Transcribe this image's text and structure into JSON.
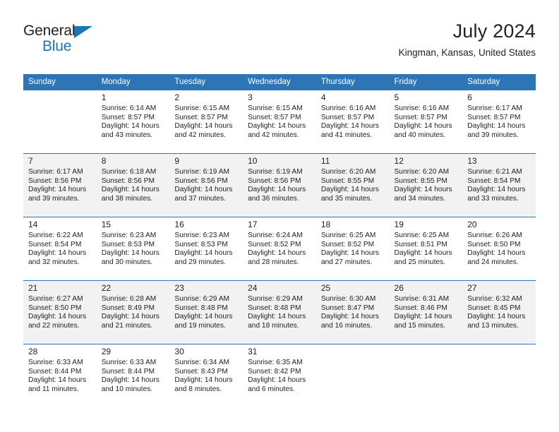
{
  "brand": {
    "line1": "General",
    "line2": "Blue"
  },
  "header": {
    "month_title": "July 2024",
    "location": "Kingman, Kansas, United States"
  },
  "calendar": {
    "weekday_headers": [
      "Sunday",
      "Monday",
      "Tuesday",
      "Wednesday",
      "Thursday",
      "Friday",
      "Saturday"
    ],
    "accent_color": "#2e75b6",
    "shaded_row_color": "#f2f2f2",
    "weeks": [
      [
        {
          "day": "",
          "sunrise": "",
          "sunset": "",
          "daylight_1": "",
          "daylight_2": ""
        },
        {
          "day": "1",
          "sunrise": "Sunrise: 6:14 AM",
          "sunset": "Sunset: 8:57 PM",
          "daylight_1": "Daylight: 14 hours",
          "daylight_2": "and 43 minutes."
        },
        {
          "day": "2",
          "sunrise": "Sunrise: 6:15 AM",
          "sunset": "Sunset: 8:57 PM",
          "daylight_1": "Daylight: 14 hours",
          "daylight_2": "and 42 minutes."
        },
        {
          "day": "3",
          "sunrise": "Sunrise: 6:15 AM",
          "sunset": "Sunset: 8:57 PM",
          "daylight_1": "Daylight: 14 hours",
          "daylight_2": "and 42 minutes."
        },
        {
          "day": "4",
          "sunrise": "Sunrise: 6:16 AM",
          "sunset": "Sunset: 8:57 PM",
          "daylight_1": "Daylight: 14 hours",
          "daylight_2": "and 41 minutes."
        },
        {
          "day": "5",
          "sunrise": "Sunrise: 6:16 AM",
          "sunset": "Sunset: 8:57 PM",
          "daylight_1": "Daylight: 14 hours",
          "daylight_2": "and 40 minutes."
        },
        {
          "day": "6",
          "sunrise": "Sunrise: 6:17 AM",
          "sunset": "Sunset: 8:57 PM",
          "daylight_1": "Daylight: 14 hours",
          "daylight_2": "and 39 minutes."
        }
      ],
      [
        {
          "day": "7",
          "sunrise": "Sunrise: 6:17 AM",
          "sunset": "Sunset: 8:56 PM",
          "daylight_1": "Daylight: 14 hours",
          "daylight_2": "and 39 minutes."
        },
        {
          "day": "8",
          "sunrise": "Sunrise: 6:18 AM",
          "sunset": "Sunset: 8:56 PM",
          "daylight_1": "Daylight: 14 hours",
          "daylight_2": "and 38 minutes."
        },
        {
          "day": "9",
          "sunrise": "Sunrise: 6:19 AM",
          "sunset": "Sunset: 8:56 PM",
          "daylight_1": "Daylight: 14 hours",
          "daylight_2": "and 37 minutes."
        },
        {
          "day": "10",
          "sunrise": "Sunrise: 6:19 AM",
          "sunset": "Sunset: 8:56 PM",
          "daylight_1": "Daylight: 14 hours",
          "daylight_2": "and 36 minutes."
        },
        {
          "day": "11",
          "sunrise": "Sunrise: 6:20 AM",
          "sunset": "Sunset: 8:55 PM",
          "daylight_1": "Daylight: 14 hours",
          "daylight_2": "and 35 minutes."
        },
        {
          "day": "12",
          "sunrise": "Sunrise: 6:20 AM",
          "sunset": "Sunset: 8:55 PM",
          "daylight_1": "Daylight: 14 hours",
          "daylight_2": "and 34 minutes."
        },
        {
          "day": "13",
          "sunrise": "Sunrise: 6:21 AM",
          "sunset": "Sunset: 8:54 PM",
          "daylight_1": "Daylight: 14 hours",
          "daylight_2": "and 33 minutes."
        }
      ],
      [
        {
          "day": "14",
          "sunrise": "Sunrise: 6:22 AM",
          "sunset": "Sunset: 8:54 PM",
          "daylight_1": "Daylight: 14 hours",
          "daylight_2": "and 32 minutes."
        },
        {
          "day": "15",
          "sunrise": "Sunrise: 6:23 AM",
          "sunset": "Sunset: 8:53 PM",
          "daylight_1": "Daylight: 14 hours",
          "daylight_2": "and 30 minutes."
        },
        {
          "day": "16",
          "sunrise": "Sunrise: 6:23 AM",
          "sunset": "Sunset: 8:53 PM",
          "daylight_1": "Daylight: 14 hours",
          "daylight_2": "and 29 minutes."
        },
        {
          "day": "17",
          "sunrise": "Sunrise: 6:24 AM",
          "sunset": "Sunset: 8:52 PM",
          "daylight_1": "Daylight: 14 hours",
          "daylight_2": "and 28 minutes."
        },
        {
          "day": "18",
          "sunrise": "Sunrise: 6:25 AM",
          "sunset": "Sunset: 8:52 PM",
          "daylight_1": "Daylight: 14 hours",
          "daylight_2": "and 27 minutes."
        },
        {
          "day": "19",
          "sunrise": "Sunrise: 6:25 AM",
          "sunset": "Sunset: 8:51 PM",
          "daylight_1": "Daylight: 14 hours",
          "daylight_2": "and 25 minutes."
        },
        {
          "day": "20",
          "sunrise": "Sunrise: 6:26 AM",
          "sunset": "Sunset: 8:50 PM",
          "daylight_1": "Daylight: 14 hours",
          "daylight_2": "and 24 minutes."
        }
      ],
      [
        {
          "day": "21",
          "sunrise": "Sunrise: 6:27 AM",
          "sunset": "Sunset: 8:50 PM",
          "daylight_1": "Daylight: 14 hours",
          "daylight_2": "and 22 minutes."
        },
        {
          "day": "22",
          "sunrise": "Sunrise: 6:28 AM",
          "sunset": "Sunset: 8:49 PM",
          "daylight_1": "Daylight: 14 hours",
          "daylight_2": "and 21 minutes."
        },
        {
          "day": "23",
          "sunrise": "Sunrise: 6:29 AM",
          "sunset": "Sunset: 8:48 PM",
          "daylight_1": "Daylight: 14 hours",
          "daylight_2": "and 19 minutes."
        },
        {
          "day": "24",
          "sunrise": "Sunrise: 6:29 AM",
          "sunset": "Sunset: 8:48 PM",
          "daylight_1": "Daylight: 14 hours",
          "daylight_2": "and 18 minutes."
        },
        {
          "day": "25",
          "sunrise": "Sunrise: 6:30 AM",
          "sunset": "Sunset: 8:47 PM",
          "daylight_1": "Daylight: 14 hours",
          "daylight_2": "and 16 minutes."
        },
        {
          "day": "26",
          "sunrise": "Sunrise: 6:31 AM",
          "sunset": "Sunset: 8:46 PM",
          "daylight_1": "Daylight: 14 hours",
          "daylight_2": "and 15 minutes."
        },
        {
          "day": "27",
          "sunrise": "Sunrise: 6:32 AM",
          "sunset": "Sunset: 8:45 PM",
          "daylight_1": "Daylight: 14 hours",
          "daylight_2": "and 13 minutes."
        }
      ],
      [
        {
          "day": "28",
          "sunrise": "Sunrise: 6:33 AM",
          "sunset": "Sunset: 8:44 PM",
          "daylight_1": "Daylight: 14 hours",
          "daylight_2": "and 11 minutes."
        },
        {
          "day": "29",
          "sunrise": "Sunrise: 6:33 AM",
          "sunset": "Sunset: 8:44 PM",
          "daylight_1": "Daylight: 14 hours",
          "daylight_2": "and 10 minutes."
        },
        {
          "day": "30",
          "sunrise": "Sunrise: 6:34 AM",
          "sunset": "Sunset: 8:43 PM",
          "daylight_1": "Daylight: 14 hours",
          "daylight_2": "and 8 minutes."
        },
        {
          "day": "31",
          "sunrise": "Sunrise: 6:35 AM",
          "sunset": "Sunset: 8:42 PM",
          "daylight_1": "Daylight: 14 hours",
          "daylight_2": "and 6 minutes."
        },
        {
          "day": "",
          "sunrise": "",
          "sunset": "",
          "daylight_1": "",
          "daylight_2": ""
        },
        {
          "day": "",
          "sunrise": "",
          "sunset": "",
          "daylight_1": "",
          "daylight_2": ""
        },
        {
          "day": "",
          "sunrise": "",
          "sunset": "",
          "daylight_1": "",
          "daylight_2": ""
        }
      ]
    ]
  }
}
